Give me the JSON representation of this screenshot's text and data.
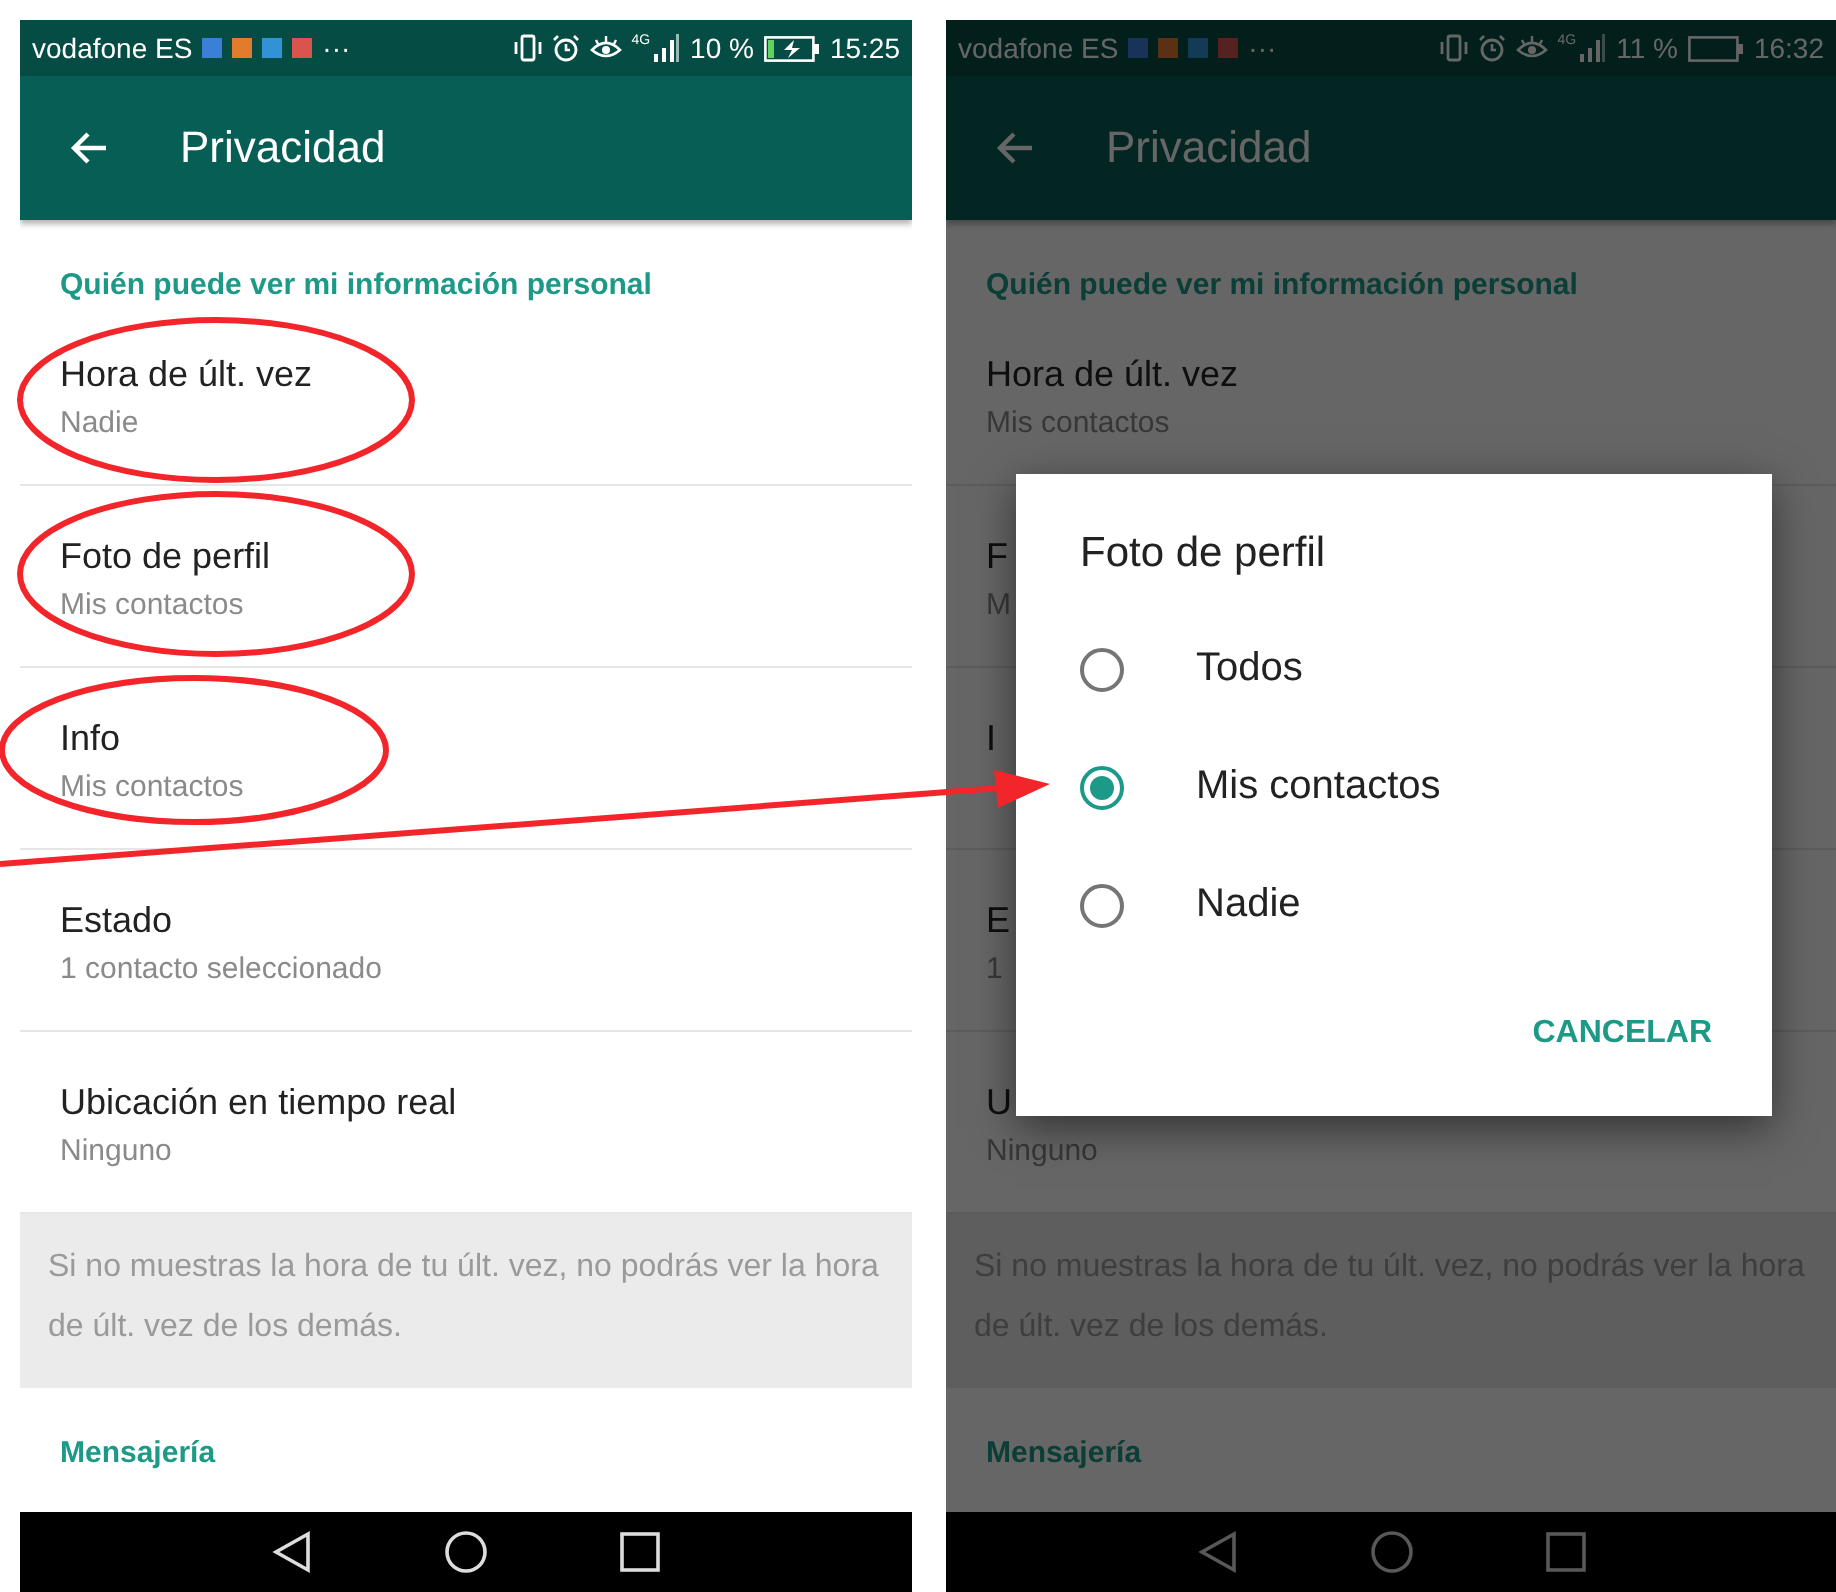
{
  "screens": [
    {
      "dimmed": false,
      "status_bar": {
        "carrier": "vodafone ES",
        "notifications": [
          {
            "color": "#3b7fd9"
          },
          {
            "color": "#e27b2c"
          },
          {
            "color": "#2f93d6"
          },
          {
            "color": "#d9534f"
          }
        ],
        "more": "···",
        "network": "4G",
        "battery_percent": "10 %",
        "charging": true,
        "time": "15:25"
      },
      "app_bar": {
        "title": "Privacidad"
      },
      "sections": [
        {
          "header": "Quién puede ver mi información personal",
          "rows": [
            {
              "title": "Hora de últ. vez",
              "value": "Nadie"
            },
            {
              "title": "Foto de perfil",
              "value": "Mis contactos"
            },
            {
              "title": "Info",
              "value": "Mis contactos"
            },
            {
              "title": "Estado",
              "value": "1 contacto seleccionado"
            },
            {
              "title": "Ubicación en tiempo real",
              "value": "Ninguno"
            }
          ],
          "note": "Si no muestras la hora de tu últ. vez, no podrás ver la hora de últ. vez de los demás."
        },
        {
          "header": "Mensajería"
        }
      ]
    },
    {
      "dimmed": true,
      "status_bar": {
        "carrier": "vodafone ES",
        "notifications": [
          {
            "color": "#183357"
          },
          {
            "color": "#5a3112"
          },
          {
            "color": "#133b56"
          },
          {
            "color": "#572120"
          }
        ],
        "more": "···",
        "network": "4G",
        "battery_percent": "11 %",
        "charging": false,
        "time": "16:32"
      },
      "app_bar": {
        "title": "Privacidad"
      },
      "sections": [
        {
          "header": "Quién puede ver mi información personal",
          "rows": [
            {
              "title": "Hora de últ. vez",
              "value": "Mis contactos"
            },
            {
              "title": "F",
              "value": "M"
            },
            {
              "title": "I"
            },
            {
              "title": "E",
              "value": "1"
            },
            {
              "title": "U",
              "value": "Ninguno"
            }
          ],
          "note": "Si no muestras la hora de tu últ. vez, no podrás ver la hora de últ. vez de los demás."
        },
        {
          "header": "Mensajería"
        }
      ],
      "dialog": {
        "title": "Foto de perfil",
        "options": [
          {
            "label": "Todos",
            "selected": false
          },
          {
            "label": "Mis contactos",
            "selected": true
          },
          {
            "label": "Nadie",
            "selected": false
          }
        ],
        "button": "CANCELAR"
      }
    }
  ]
}
